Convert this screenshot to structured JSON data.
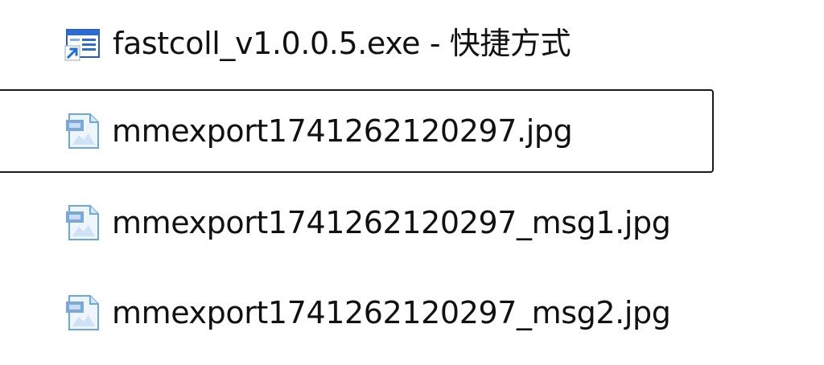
{
  "files": [
    {
      "name": "fastcoll_v1.0.0.5.exe - 快捷方式",
      "icon": "shortcut-exe-icon",
      "selected": false
    },
    {
      "name": "mmexport1741262120297.jpg",
      "icon": "jpg-file-icon",
      "selected": true
    },
    {
      "name": "mmexport1741262120297_msg1.jpg",
      "icon": "jpg-file-icon",
      "selected": false
    },
    {
      "name": "mmexport1741262120297_msg2.jpg",
      "icon": "jpg-file-icon",
      "selected": false
    }
  ],
  "colors": {
    "text": "#111111",
    "focus_border": "#1a1a1a",
    "shortcut_arrow": "#1e6fd9",
    "jpg_icon_blue": "#6aa6e0"
  }
}
